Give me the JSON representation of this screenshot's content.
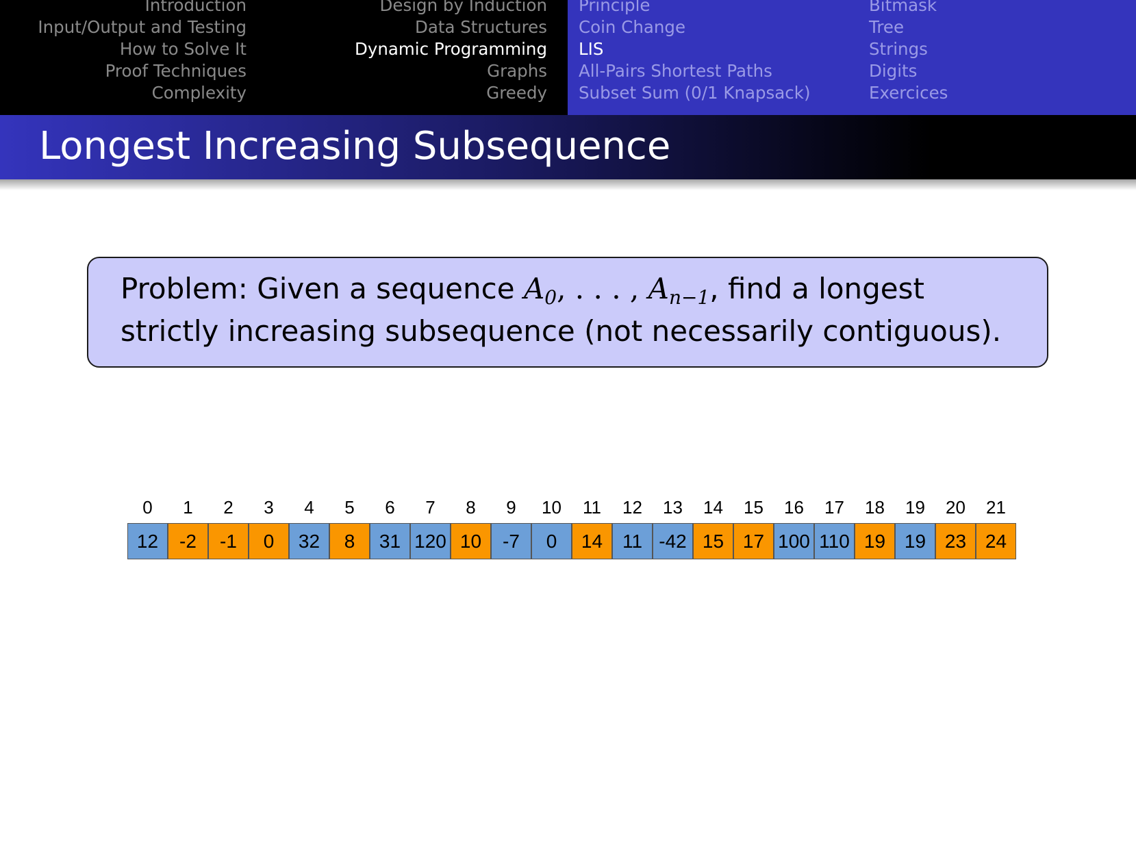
{
  "nav": {
    "col1": [
      "Introduction",
      "Input/Output and Testing",
      "How to Solve It",
      "Proof Techniques",
      "Complexity"
    ],
    "col2": [
      "Design by Induction",
      "Data Structures",
      "Dynamic Programming",
      "Graphs",
      "Greedy"
    ],
    "col3": [
      "Principle",
      "Coin Change",
      "LIS",
      "All-Pairs Shortest Paths",
      "Subset Sum (0/1 Knapsack)"
    ],
    "col4": [
      "Bitmask",
      "Tree",
      "Strings",
      "Digits",
      "Exercices"
    ],
    "current_section": "Dynamic Programming",
    "current_subsection": "LIS"
  },
  "title": "Longest Increasing Subsequence",
  "problem": {
    "lead": "Problem:  Given a sequence ",
    "var": "A",
    "sub0": "0",
    "ellipsis": ", . . . , ",
    "subn": "n−1",
    "rest": ", find a longest strictly increasing subsequence (not necessarily contiguous)."
  },
  "array": {
    "indices": [
      "0",
      "1",
      "2",
      "3",
      "4",
      "5",
      "6",
      "7",
      "8",
      "9",
      "10",
      "11",
      "12",
      "13",
      "14",
      "15",
      "16",
      "17",
      "18",
      "19",
      "20",
      "21"
    ],
    "values": [
      "12",
      "-2",
      "-1",
      "0",
      "32",
      "8",
      "31",
      "120",
      "10",
      "-7",
      "0",
      "14",
      "11",
      "-42",
      "15",
      "17",
      "100",
      "110",
      "19",
      "19",
      "23",
      "24"
    ],
    "highlighted": [
      false,
      true,
      true,
      true,
      false,
      true,
      false,
      false,
      true,
      false,
      false,
      true,
      false,
      false,
      true,
      true,
      false,
      false,
      true,
      false,
      true,
      true
    ],
    "colors": {
      "normal": "#6c9fd8",
      "highlight": "#fa9600"
    }
  }
}
